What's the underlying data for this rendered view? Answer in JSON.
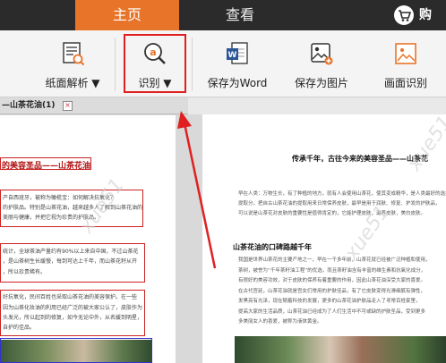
{
  "menu": {
    "tabs": [
      {
        "label": "主页",
        "active": true
      },
      {
        "label": "查看",
        "active": false
      }
    ],
    "cart_label": "购"
  },
  "toolbar": {
    "items": [
      {
        "label": "纸面解析 ▼",
        "icon": "paper-analysis-icon"
      },
      {
        "label": "识别 ▼",
        "icon": "recognize-icon"
      },
      {
        "label": "保存为Word",
        "icon": "word-doc-icon"
      },
      {
        "label": "保存为图片",
        "icon": "save-image-icon"
      },
      {
        "label": "画面识别",
        "icon": "screen-recognize-icon"
      }
    ]
  },
  "document_tab": {
    "name": "—山茶花油(1)",
    "close": "×"
  },
  "left_pane": {
    "heading": "的美容圣品——山茶花油",
    "paragraph1": [
      "产自西班牙，被称为橄榄宝：如何解决抗氧化？",
      "的护肤品。特别是山茶花油，越来越多人了解到山茶花油的",
      "美丽与健康，并把它视为珍贵的护肤品。"
    ],
    "paragraph2": [
      "统计，全球茶油产量约有90%以上来自中国，不过山茶花",
      "，是山茶树生长缓慢，每到可达上千年，而山茶花籽从开",
      "，所以珍贵稀有。",
      "好抗氧化，民间百姓也采取山茶花油的美容保护。在一些",
      "因为山茶化妆油的利用已经广泛的被大家公认了，皮肤作为",
      "头发光，所以起到的修复，如今无论中外，从名媛到明星，",
      "自护的佳品。"
    ]
  },
  "right_pane": {
    "title": "传承千年，古往今来的美容圣品——山茶花",
    "body1": [
      "早在人类：万物生长，有了种植的地方，就有人会使用山茶花，使其变成精华，是人类最好的选择。",
      "提取分，把自古山茶花油的提取用来日常保养皮肤，最早是用于润肤、修复、护发的护肤品，",
      "可以说是山茶花对皮肤的重要性是值得肯定的，它能护理皮肤，滋养皮肤，美白皮肤。"
    ],
    "subtitle": "山茶花油的口碑路越千年",
    "body2": [
      "我国是世界山茶花的主要产地之一，早在一千多年前，山茶花就已经被广泛种植和使用，",
      "茶树，被誉为“千年茶籽油工程”的优选，而且茶籽油含有丰富的维生素和抗氧化成分，",
      "有很好的美容功效，对于皮肤的保养有着重要的作用，因此山茶花油深受大家的喜爱。",
      "在古代宫廷，山茶花油就是宫女们常用的护肤佳品，有了它皮肤变得光滑细腻有弹性，",
      "发黑亮有光泽，现在随着科技的发展，更多的山茶花油护肤品走入了寻常百姓家里，",
      "提高大家的生活品质，山茶花油已经成为了人们生活中不可或缺的护肤圣品，受到更多",
      "多美丽女人的喜爱，被称为液体黄金。"
    ]
  },
  "colors": {
    "accent": "#e8742a",
    "highlight": "#e02020",
    "topbar": "#2b2b2b"
  }
}
